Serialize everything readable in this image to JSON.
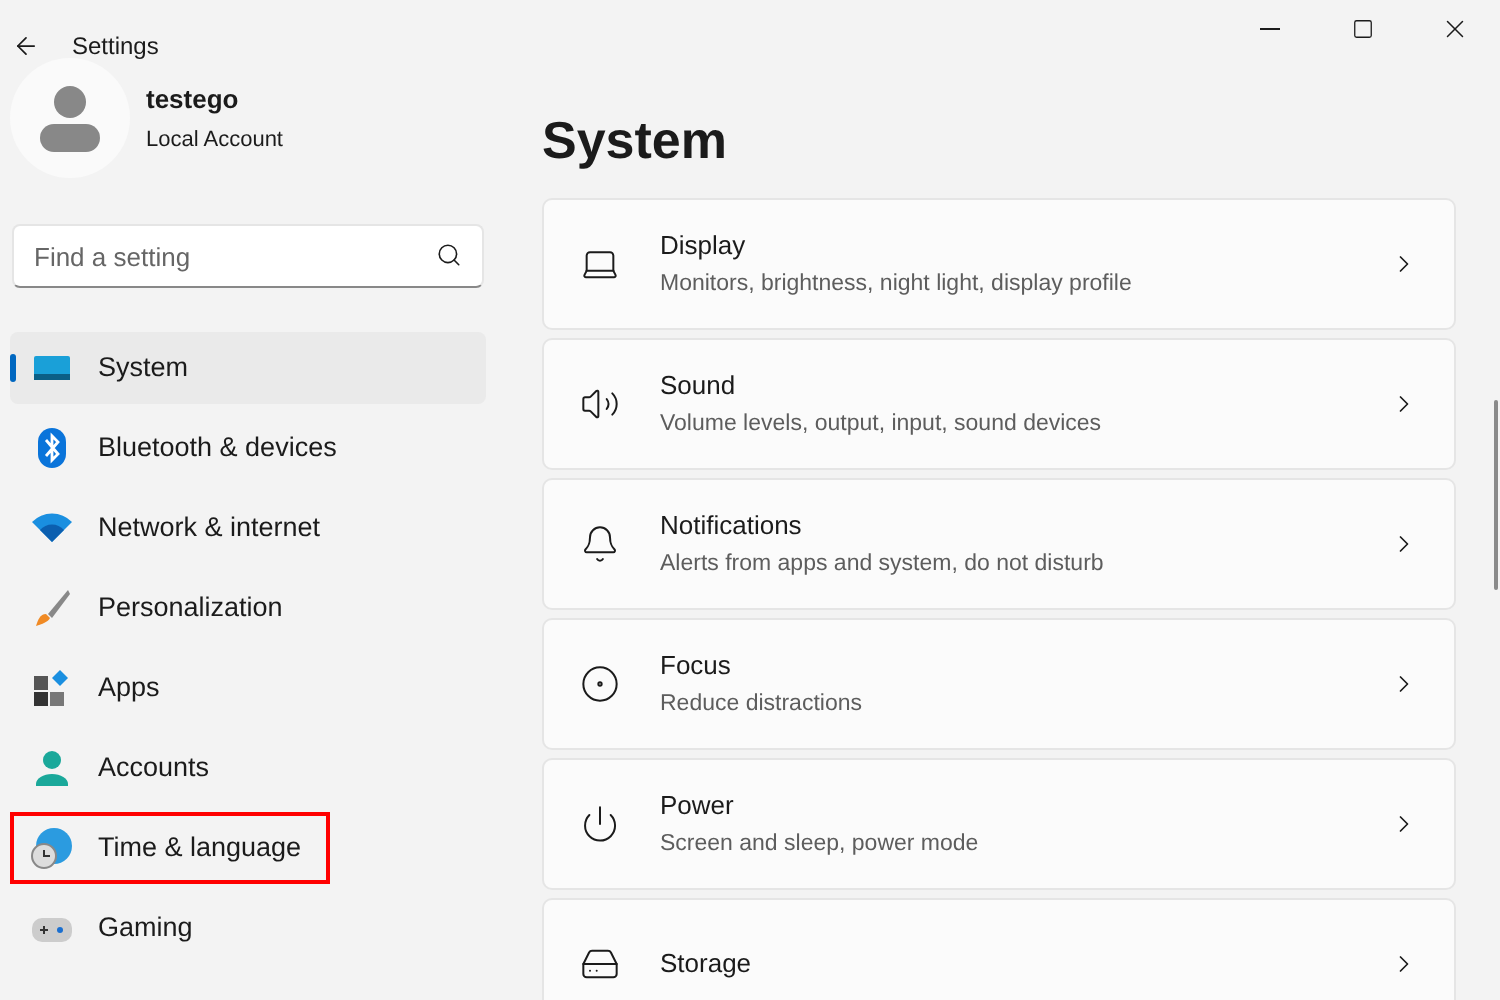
{
  "window": {
    "title": "Settings"
  },
  "account": {
    "name": "testego",
    "type": "Local Account"
  },
  "search": {
    "placeholder": "Find a setting"
  },
  "sidebar": {
    "items": [
      {
        "label": "System",
        "selected": true,
        "highlighted": false
      },
      {
        "label": "Bluetooth & devices",
        "selected": false,
        "highlighted": false
      },
      {
        "label": "Network & internet",
        "selected": false,
        "highlighted": false
      },
      {
        "label": "Personalization",
        "selected": false,
        "highlighted": false
      },
      {
        "label": "Apps",
        "selected": false,
        "highlighted": false
      },
      {
        "label": "Accounts",
        "selected": false,
        "highlighted": false
      },
      {
        "label": "Time & language",
        "selected": false,
        "highlighted": true
      },
      {
        "label": "Gaming",
        "selected": false,
        "highlighted": false
      }
    ]
  },
  "page": {
    "title": "System",
    "cards": [
      {
        "title": "Display",
        "subtitle": "Monitors, brightness, night light, display profile"
      },
      {
        "title": "Sound",
        "subtitle": "Volume levels, output, input, sound devices"
      },
      {
        "title": "Notifications",
        "subtitle": "Alerts from apps and system, do not disturb"
      },
      {
        "title": "Focus",
        "subtitle": "Reduce distractions"
      },
      {
        "title": "Power",
        "subtitle": "Screen and sleep, power mode"
      },
      {
        "title": "Storage"
      }
    ]
  }
}
